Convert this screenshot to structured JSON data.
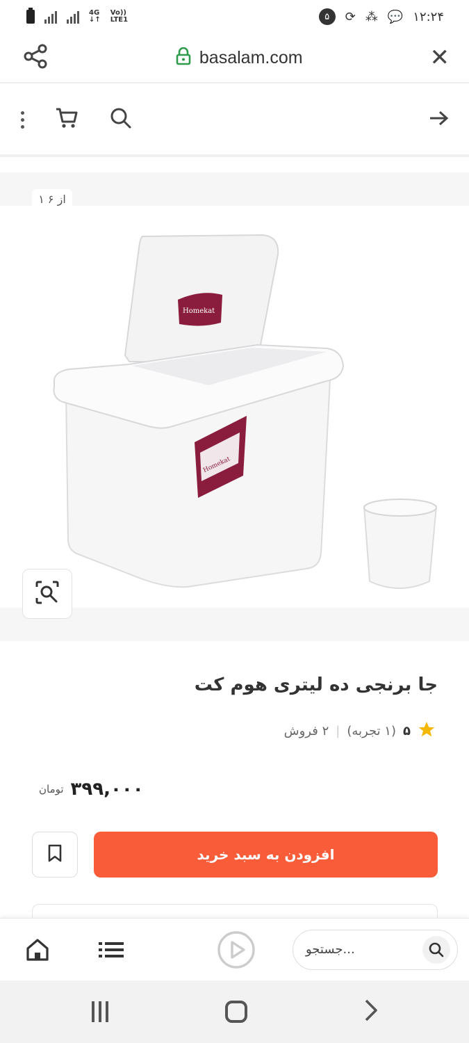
{
  "status_bar": {
    "network": "4G",
    "volte": "Vo))",
    "lte": "LTE1",
    "notification_badge": "۵",
    "time": "۱۲:۲۴"
  },
  "browser": {
    "url": "basalam.com"
  },
  "gallery": {
    "counter": "۱ از ۶",
    "brand_on_label": "Homekat"
  },
  "product": {
    "title": "جا برنجی ده لیتری هوم کت",
    "rating": "۵",
    "reviews": "(۱ تجربه)",
    "sales": "۲ فروش",
    "price": "۳۹۹,۰۰۰",
    "currency": "تومان"
  },
  "actions": {
    "add_to_cart": "افزودن به سبد خرید"
  },
  "bottom_nav": {
    "search_placeholder": "جستجو..."
  },
  "colors": {
    "accent": "#f85c38",
    "star": "#f5b800",
    "lock": "#2e9c4a"
  }
}
